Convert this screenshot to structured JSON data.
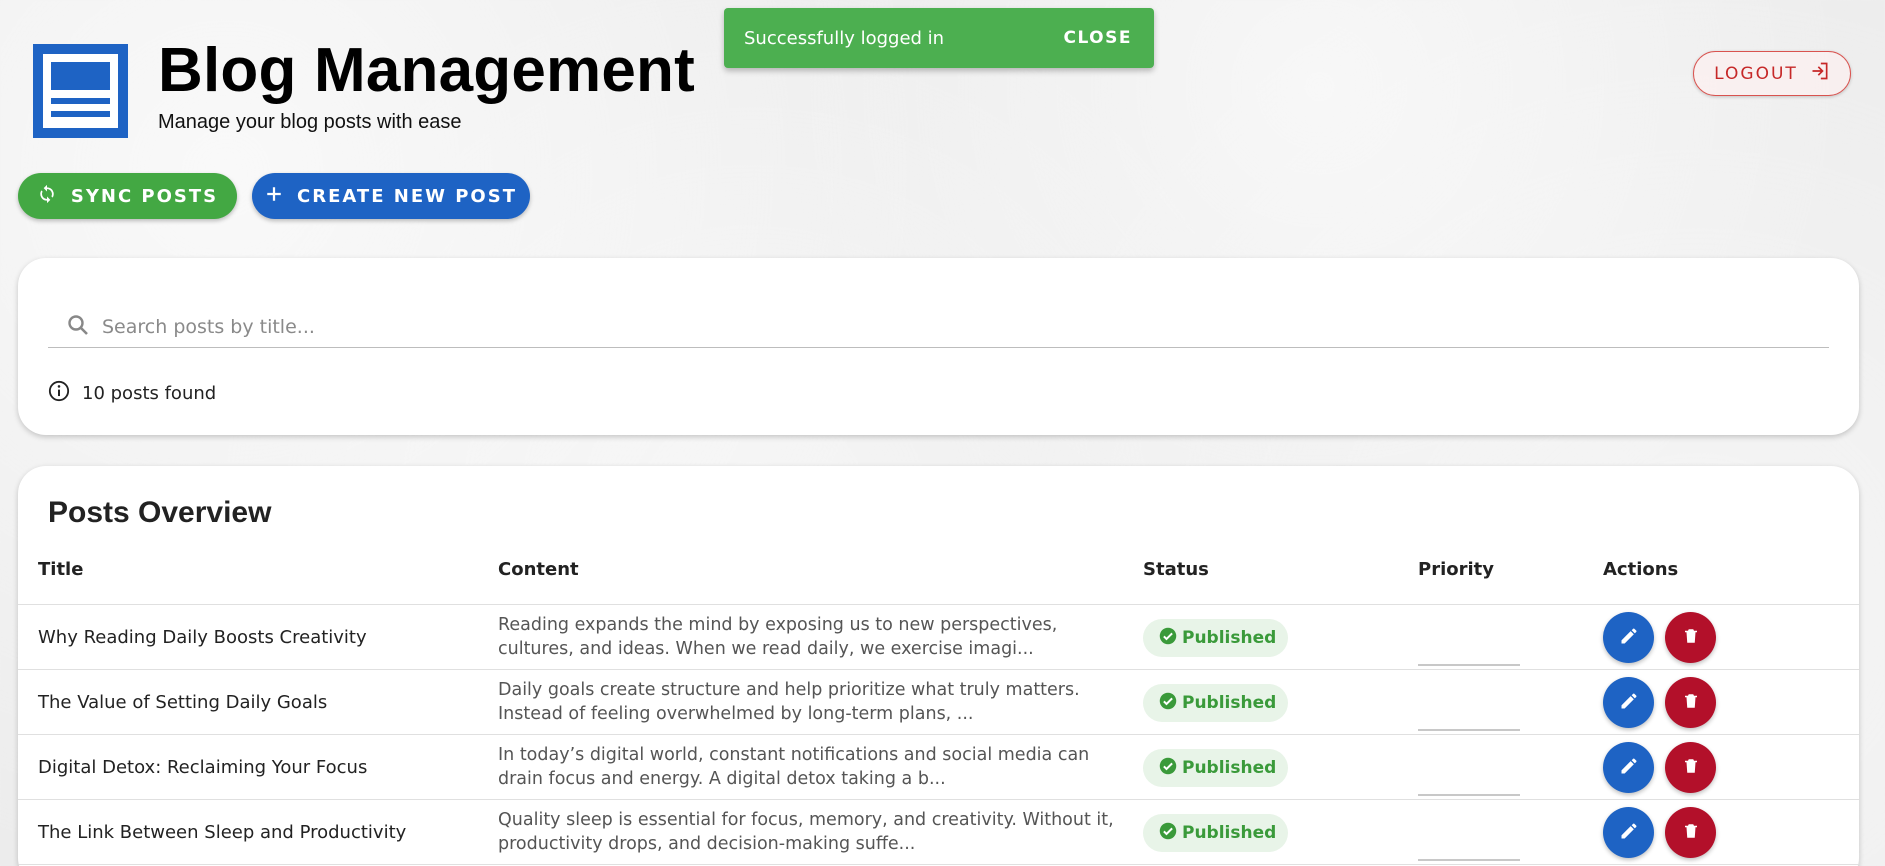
{
  "header": {
    "title": "Blog Management",
    "subtitle": "Manage your blog posts with ease",
    "logout_label": "LOGOUT"
  },
  "snackbar": {
    "message": "Successfully logged in",
    "close_label": "CLOSE"
  },
  "actions": {
    "sync_label": "SYNC POSTS",
    "create_label": "CREATE NEW POST"
  },
  "search": {
    "placeholder": "Search posts by title...",
    "value": "",
    "count_text": "10 posts found"
  },
  "posts": {
    "heading": "Posts Overview",
    "columns": [
      "Title",
      "Content",
      "Status",
      "Priority",
      "Actions"
    ],
    "rows": [
      {
        "title": "Why Reading Daily Boosts Creativity",
        "content": "Reading expands the mind by exposing us to new perspectives, cultures, and ideas. When we read daily, we exercise imagi...",
        "status": "Published",
        "priority": ""
      },
      {
        "title": "The Value of Setting Daily Goals",
        "content": "Daily goals create structure and help prioritize what truly matters. Instead of feeling overwhelmed by long-term plans, ...",
        "status": "Published",
        "priority": ""
      },
      {
        "title": "Digital Detox: Reclaiming Your Focus",
        "content": "In today’s digital world, constant notifications and social media can drain focus and energy. A digital detox taking a b...",
        "status": "Published",
        "priority": ""
      },
      {
        "title": "The Link Between Sleep and Productivity",
        "content": "Quality sleep is essential for focus, memory, and creativity. Without it, productivity drops, and decision-making suffe...",
        "status": "Published",
        "priority": ""
      }
    ]
  },
  "colors": {
    "primary": "#1e63c4",
    "success": "#4caf50",
    "danger": "#b3102a",
    "logout": "#c62828"
  },
  "icons": {
    "logo": "blog-logo-icon",
    "sync": "sync-icon",
    "create": "plus-icon",
    "logout": "logout-icon",
    "search": "search-icon",
    "info": "info-icon",
    "status": "check-circle-icon",
    "edit": "pencil-icon",
    "delete": "trash-icon"
  }
}
